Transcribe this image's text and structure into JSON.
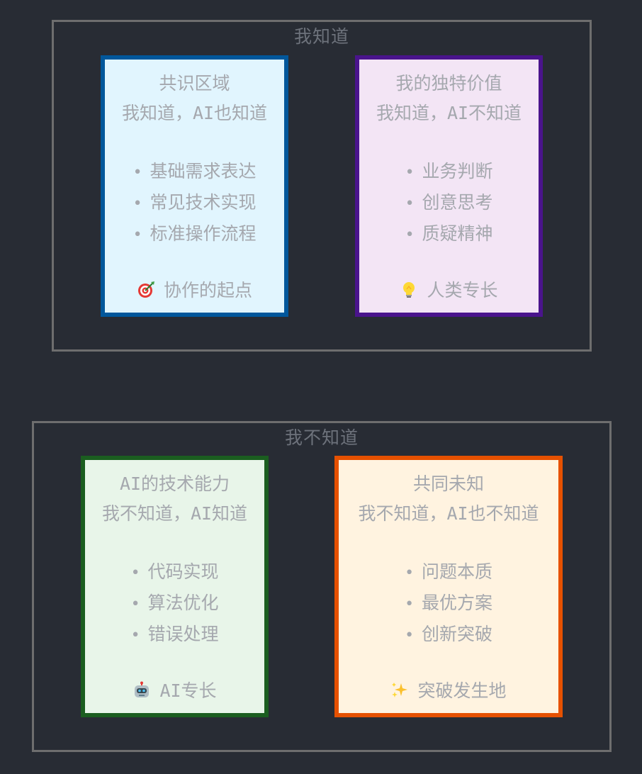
{
  "groups": {
    "know": {
      "title": "我知道"
    },
    "unknown": {
      "title": "我不知道"
    }
  },
  "quadrants": {
    "consensus": {
      "title": "共识区域",
      "subtitle": "我知道，AI也知道",
      "items": [
        "基础需求表达",
        "常见技术实现",
        "标准操作流程"
      ],
      "footer_icon": "target-icon",
      "footer": "协作的起点",
      "fill": "#e1f5fe",
      "stroke": "#01579b"
    },
    "unique_value": {
      "title": "我的独特价值",
      "subtitle": "我知道，AI不知道",
      "items": [
        "业务判断",
        "创意思考",
        "质疑精神"
      ],
      "footer_icon": "lightbulb-icon",
      "footer": "人类专长",
      "fill": "#f3e5f5",
      "stroke": "#4a148c"
    },
    "ai_capability": {
      "title": "AI的技术能力",
      "subtitle": "我不知道，AI知道",
      "items": [
        "代码实现",
        "算法优化",
        "错误处理"
      ],
      "footer_icon": "robot-icon",
      "footer": "AI专长",
      "fill": "#e8f5e9",
      "stroke": "#1b5e20"
    },
    "shared_unknown": {
      "title": "共同未知",
      "subtitle": "我不知道，AI也不知道",
      "items": [
        "问题本质",
        "最优方案",
        "创新突破"
      ],
      "footer_icon": "sparkles-icon",
      "footer": "突破发生地",
      "fill": "#fff3e0",
      "stroke": "#e65100"
    }
  }
}
